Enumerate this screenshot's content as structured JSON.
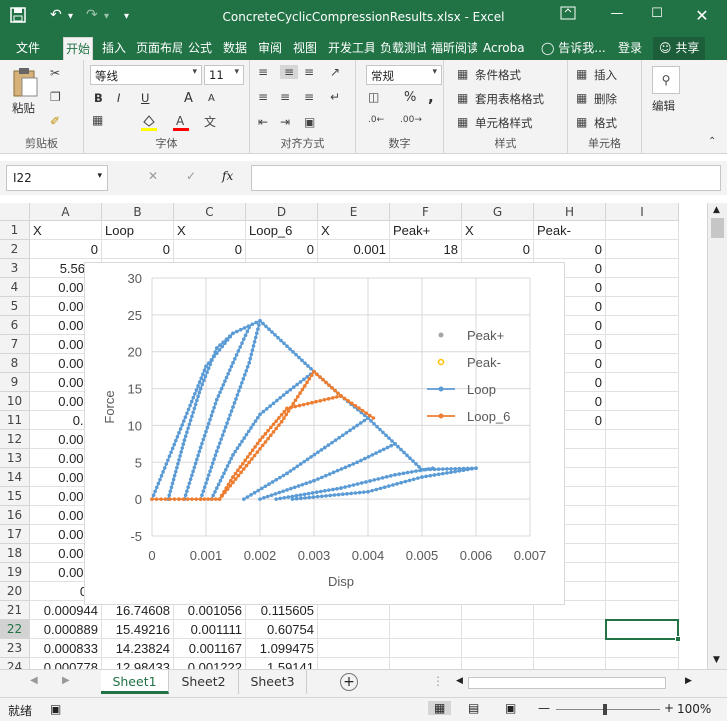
{
  "titlebar": {
    "doc_title": "ConcreteCyclicCompressionResults.xlsx - Excel",
    "save_icon": "save-icon",
    "undo_icon": "undo-icon",
    "redo_icon": "redo-icon"
  },
  "tabs": [
    "文件",
    "开始",
    "插入",
    "页面布局",
    "公式",
    "数据",
    "审阅",
    "视图",
    "开发工具",
    "负载测试",
    "福昕阅读",
    "Acroba",
    "告诉我...",
    "登录",
    "共享"
  ],
  "active_tab": "开始",
  "ribbon": {
    "clipboard": {
      "paste": "粘贴",
      "label": "剪贴板"
    },
    "font": {
      "name": "等线",
      "size": "11",
      "label": "字体",
      "bold": "B",
      "italic": "I",
      "underline": "U",
      "grow": "A",
      "shrink": "A"
    },
    "align": {
      "label": "对齐方式"
    },
    "number": {
      "format": "常规",
      "percent": "%",
      "comma": ",",
      "label": "数字"
    },
    "styles": {
      "cond": "条件格式",
      "table": "套用表格格式",
      "cell": "单元格样式",
      "label": "样式"
    },
    "cells": {
      "insert": "插入",
      "delete": "删除",
      "format": "格式",
      "label": "单元格"
    },
    "edit": {
      "label": "编辑"
    }
  },
  "formula_bar": {
    "name_box": "I22",
    "fx": "fx",
    "content": ""
  },
  "columns": [
    "A",
    "B",
    "C",
    "D",
    "E",
    "F",
    "G",
    "H",
    "I"
  ],
  "rows": [
    [
      "X",
      "Loop",
      "X",
      "Loop_6",
      "X",
      "Peak+",
      "X",
      "Peak-"
    ],
    [
      "0",
      "0",
      "0",
      "0",
      "0.001",
      "18",
      "0",
      "0"
    ],
    [
      "5.56E-",
      "",
      "",
      "",
      "",
      "",
      "",
      "0"
    ],
    [
      "0.0001",
      "",
      "",
      "",
      "",
      "",
      "",
      "0"
    ],
    [
      "0.0001",
      "",
      "",
      "",
      "",
      "",
      "",
      "0"
    ],
    [
      "0.0002",
      "",
      "",
      "",
      "",
      "",
      "",
      "0"
    ],
    [
      "0.0002",
      "",
      "",
      "",
      "",
      "",
      "",
      "0"
    ],
    [
      "0.0003",
      "",
      "",
      "",
      "",
      "",
      "",
      "0"
    ],
    [
      "0.0003",
      "",
      "",
      "",
      "",
      "",
      "",
      "0"
    ],
    [
      "0.0004",
      "",
      "",
      "",
      "",
      "",
      "",
      "0"
    ],
    [
      "0.00",
      "",
      "",
      "",
      "",
      "",
      "",
      "0"
    ],
    [
      "0.0005",
      "",
      "",
      "",
      "",
      "",
      "",
      ""
    ],
    [
      "0.0006",
      "",
      "",
      "",
      "",
      "",
      "",
      ""
    ],
    [
      "0.0006",
      "",
      "",
      "",
      "",
      "",
      "",
      ""
    ],
    [
      "0.0007",
      "",
      "",
      "",
      "",
      "",
      "",
      ""
    ],
    [
      "0.0007",
      "",
      "",
      "",
      "",
      "",
      "",
      ""
    ],
    [
      "0.0008",
      "",
      "",
      "",
      "",
      "",
      "",
      ""
    ],
    [
      "0.0008",
      "",
      "",
      "",
      "",
      "",
      "",
      ""
    ],
    [
      "0.0009",
      "",
      "",
      "",
      "",
      "",
      "",
      ""
    ],
    [
      "0.0",
      "",
      "",
      "",
      "",
      "",
      "",
      ""
    ],
    [
      "0.000944",
      "16.74608",
      "0.001056",
      "0.115605",
      "",
      "",
      "",
      ""
    ],
    [
      "0.000889",
      "15.49216",
      "0.001111",
      "0.60754",
      "",
      "",
      "",
      ""
    ],
    [
      "0.000833",
      "14.23824",
      "0.001167",
      "1.099475",
      "",
      "",
      "",
      ""
    ],
    [
      "0.000778",
      "12.98433",
      "0.001222",
      "1.59141",
      "",
      "",
      "",
      ""
    ]
  ],
  "selected_row": "22",
  "sheets": [
    "Sheet1",
    "Sheet2",
    "Sheet3"
  ],
  "active_sheet": "Sheet1",
  "status": {
    "mode": "就绪",
    "zoom": "100%"
  },
  "chart_data": {
    "type": "scatter",
    "title": "",
    "xlabel": "Disp",
    "ylabel": "Force",
    "xlim": [
      0,
      0.007
    ],
    "ylim": [
      -5,
      30
    ],
    "x_ticks": [
      "0",
      "0.001",
      "0.002",
      "0.003",
      "0.004",
      "0.005",
      "0.006",
      "0.007"
    ],
    "y_ticks": [
      "-5",
      "0",
      "5",
      "10",
      "15",
      "20",
      "25",
      "30"
    ],
    "grid": true,
    "legend_placement": "right",
    "series": [
      {
        "name": "Peak+",
        "style": "marker",
        "color": "#a5a5a5",
        "points": []
      },
      {
        "name": "Peak-",
        "style": "marker-outline",
        "color": "#ffc000",
        "points": []
      },
      {
        "name": "Loop",
        "style": "line-marker",
        "color": "#5b9bd5",
        "segments": [
          [
            [
              0,
              0
            ],
            [
              0.0005,
              9
            ],
            [
              0.001,
              18
            ],
            [
              0.0015,
              22.5
            ],
            [
              0.002,
              24.2
            ],
            [
              0.003,
              17.3
            ],
            [
              0.0035,
              14
            ],
            [
              0.004,
              11
            ],
            [
              0.0045,
              7.5
            ],
            [
              0.005,
              4
            ],
            [
              0.006,
              4.2
            ]
          ],
          [
            [
              0.0003,
              0
            ],
            [
              0.0006,
              8
            ],
            [
              0.0009,
              15
            ],
            [
              0.0012,
              20.5
            ],
            [
              0.0015,
              22.5
            ]
          ],
          [
            [
              0.0006,
              0
            ],
            [
              0.0009,
              7
            ],
            [
              0.0012,
              13.5
            ],
            [
              0.0015,
              18.5
            ],
            [
              0.0018,
              23.3
            ]
          ],
          [
            [
              0.0009,
              0
            ],
            [
              0.0012,
              6.5
            ],
            [
              0.0015,
              12.5
            ],
            [
              0.0018,
              18.5
            ],
            [
              0.002,
              24.2
            ]
          ],
          [
            [
              0.0011,
              0
            ],
            [
              0.0015,
              6
            ],
            [
              0.002,
              11.5
            ],
            [
              0.0025,
              14.5
            ],
            [
              0.003,
              17.3
            ]
          ],
          [
            [
              0.0017,
              0
            ],
            [
              0.0025,
              3.5
            ],
            [
              0.0032,
              7
            ],
            [
              0.004,
              11
            ]
          ],
          [
            [
              0.002,
              0
            ],
            [
              0.003,
              2.5
            ],
            [
              0.0038,
              5
            ],
            [
              0.0045,
              7.5
            ]
          ],
          [
            [
              0.0023,
              0
            ],
            [
              0.0035,
              1.5
            ],
            [
              0.0045,
              3.3
            ],
            [
              0.0052,
              4.2
            ]
          ],
          [
            [
              0.0026,
              0
            ],
            [
              0.004,
              1
            ],
            [
              0.005,
              3
            ],
            [
              0.006,
              4.2
            ]
          ]
        ]
      },
      {
        "name": "Loop_6",
        "style": "line-marker",
        "color": "#ed7d31",
        "segments": [
          [
            [
              0,
              0
            ],
            [
              0.0005,
              0
            ],
            [
              0.0009,
              0
            ],
            [
              0.00125,
              0
            ],
            [
              0.0018,
              5
            ],
            [
              0.0024,
              10.5
            ],
            [
              0.003,
              17.3
            ],
            [
              0.0035,
              14
            ],
            [
              0.0041,
              11
            ]
          ],
          [
            [
              0.00125,
              0
            ],
            [
              0.0015,
              3
            ],
            [
              0.002,
              8
            ],
            [
              0.0025,
              12.3
            ],
            [
              0.0035,
              14
            ]
          ]
        ]
      }
    ]
  }
}
